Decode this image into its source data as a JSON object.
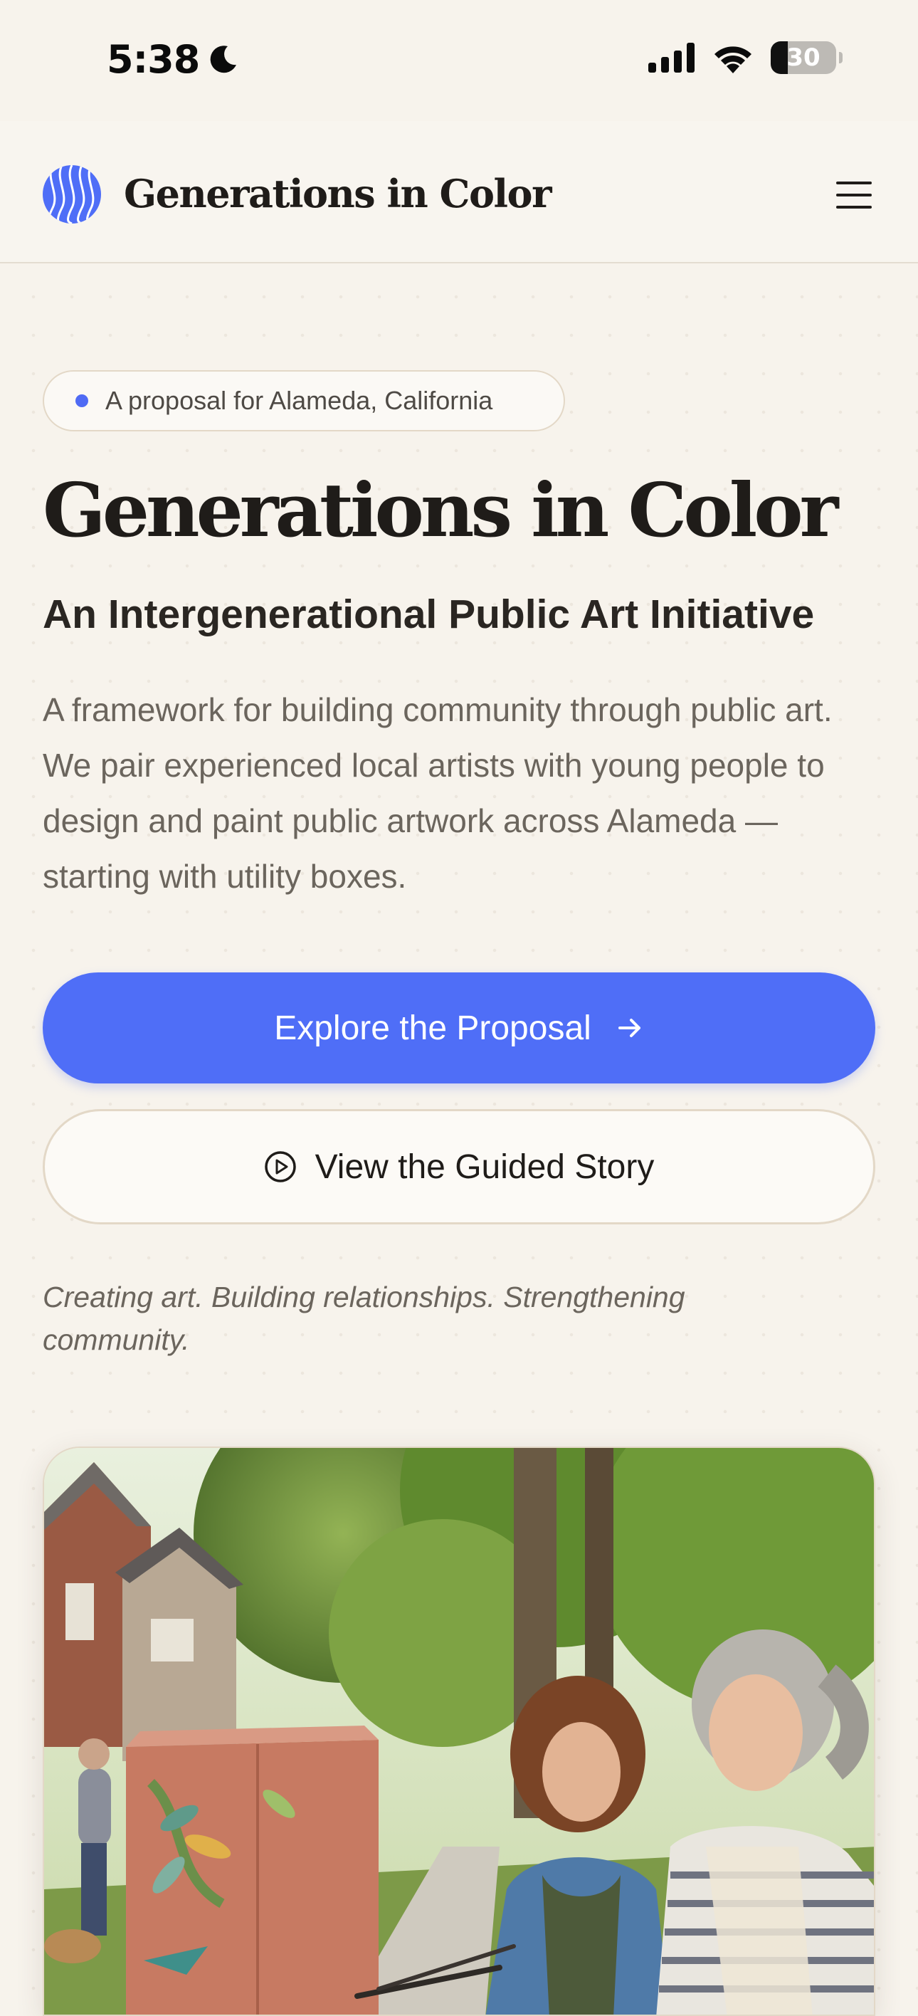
{
  "status_bar": {
    "time": "5:38",
    "battery": "30"
  },
  "header": {
    "brand": "Generations in Color"
  },
  "hero": {
    "badge": "A proposal for Alameda, California",
    "title": "Generations in Color",
    "subtitle": "An Intergenerational Public Art Initiative",
    "description": "A framework for building community through public art. We pair experienced local artists with young people to design and paint public artwork across Alameda — starting with utility boxes.",
    "primary_button": "Explore the Proposal",
    "secondary_button": "View the Guided Story",
    "tagline": "Creating art. Building relationships. Strengthening community."
  },
  "colors": {
    "accent": "#4f6ef7",
    "background": "#f7f3ec",
    "border": "#e3d8c7",
    "text": "#1f1c19",
    "muted": "#6b655d"
  },
  "icons": [
    "moon-icon",
    "signal-icon",
    "wifi-icon",
    "battery-icon",
    "logo-icon",
    "menu-icon",
    "arrow-right-icon",
    "play-circle-icon"
  ]
}
